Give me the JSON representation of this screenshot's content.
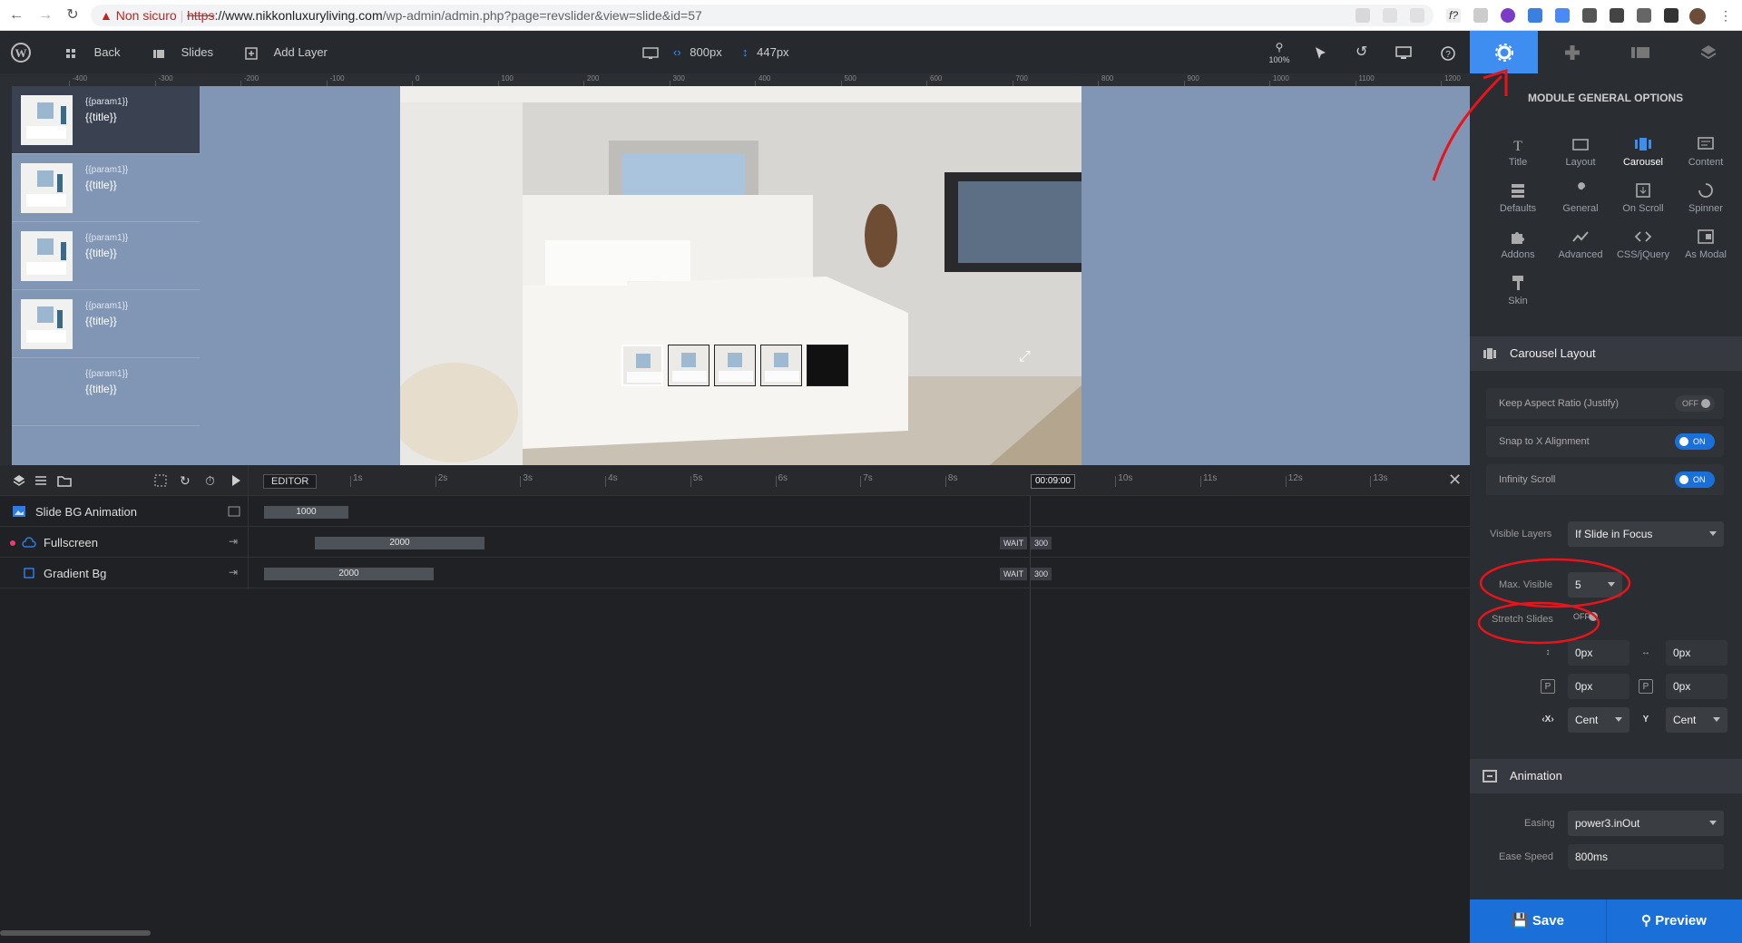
{
  "browser": {
    "security_warning": "Non sicuro",
    "url_scheme": "https",
    "url_rest_host": "://www.nikkonluxuryliving.com",
    "url_path": "/wp-admin/admin.php?page=revslider&view=slide&id=57"
  },
  "toolbar": {
    "back_label": "Back",
    "slides_label": "Slides",
    "add_layer_label": "Add Layer",
    "width_value": "800px",
    "height_value": "447px",
    "zoom_label": "100%"
  },
  "ruler_labels": [
    "-400",
    "-300",
    "-200",
    "-100",
    "0",
    "100",
    "200",
    "300",
    "400",
    "500",
    "600",
    "700",
    "800",
    "900",
    "1000",
    "1100",
    "1200"
  ],
  "slide_list": [
    {
      "param": "{{param1}}",
      "title": "{{title}}"
    },
    {
      "param": "{{param1}}",
      "title": "{{title}}"
    },
    {
      "param": "{{param1}}",
      "title": "{{title}}"
    },
    {
      "param": "{{param1}}",
      "title": "{{title}}"
    },
    {
      "param": "{{param1}}",
      "title": "{{title}}"
    }
  ],
  "timeline": {
    "editor_label": "EDITOR",
    "seconds": [
      "1s",
      "2s",
      "3s",
      "4s",
      "5s",
      "6s",
      "7s",
      "8s",
      "9s",
      "10s",
      "11s",
      "12s",
      "13s"
    ],
    "time_marker": "00:09:00",
    "rows": [
      {
        "label": "Slide BG Animation",
        "bar": "1000"
      },
      {
        "label": "Fullscreen",
        "bar": "2000",
        "wait": "WAIT",
        "wait_value": "300"
      },
      {
        "label": "Gradient Bg",
        "bar": "2000",
        "wait": "WAIT",
        "wait_value": "300"
      }
    ]
  },
  "panel": {
    "title": "MODULE GENERAL OPTIONS",
    "options": [
      {
        "label": "Title",
        "icon": "title-icon"
      },
      {
        "label": "Layout",
        "icon": "layout-icon"
      },
      {
        "label": "Carousel",
        "icon": "carousel-icon"
      },
      {
        "label": "Content",
        "icon": "content-icon"
      },
      {
        "label": "Defaults",
        "icon": "defaults-icon"
      },
      {
        "label": "General",
        "icon": "wrench-icon"
      },
      {
        "label": "On Scroll",
        "icon": "scroll-icon"
      },
      {
        "label": "Spinner",
        "icon": "spinner-icon"
      },
      {
        "label": "Addons",
        "icon": "puzzle-icon"
      },
      {
        "label": "Advanced",
        "icon": "advanced-icon"
      },
      {
        "label": "CSS/jQuery",
        "icon": "code-icon"
      },
      {
        "label": "As Modal",
        "icon": "modal-icon"
      },
      {
        "label": "Skin",
        "icon": "brush-icon"
      }
    ],
    "carousel_section": "Carousel Layout",
    "keep_aspect_label": "Keep Aspect Ratio (Justify)",
    "keep_aspect_state": "OFF",
    "snap_label": "Snap to X Alignment",
    "snap_state": "ON",
    "infinity_label": "Infinity Scroll",
    "infinity_state": "ON",
    "visible_layers_label": "Visible Layers",
    "visible_layers_value": "If Slide in Focus",
    "max_visible_label": "Max. Visible",
    "max_visible_value": "5",
    "stretch_label": "Stretch Slides",
    "stretch_state": "OFF",
    "padding_values": [
      "0px",
      "0px",
      "0px",
      "0px"
    ],
    "align_x": "Cent",
    "align_y": "Cent",
    "animation_section": "Animation",
    "easing_label": "Easing",
    "easing_value": "power3.inOut",
    "ease_speed_label": "Ease Speed",
    "ease_speed_value": "800ms",
    "save_label": "Save",
    "preview_label": "Preview"
  },
  "colors": {
    "accent": "#1b6fd8",
    "annotation": "#e8141c",
    "canvas_bg": "#8196b5"
  }
}
